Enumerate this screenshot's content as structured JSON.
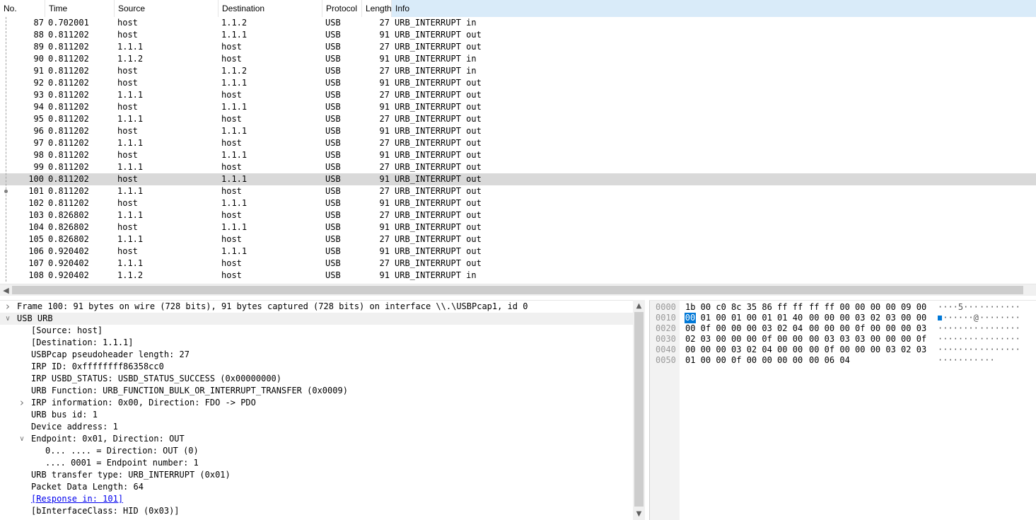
{
  "columns": [
    {
      "key": "no",
      "label": "No."
    },
    {
      "key": "time",
      "label": "Time"
    },
    {
      "key": "source",
      "label": "Source"
    },
    {
      "key": "destination",
      "label": "Destination"
    },
    {
      "key": "protocol",
      "label": "Protocol"
    },
    {
      "key": "length",
      "label": "Length"
    },
    {
      "key": "info",
      "label": "Info"
    }
  ],
  "packets": [
    {
      "no": "87",
      "time": "0.702001",
      "source": "host",
      "destination": "1.1.2",
      "protocol": "USB",
      "length": "27",
      "info": "URB_INTERRUPT in"
    },
    {
      "no": "88",
      "time": "0.811202",
      "source": "host",
      "destination": "1.1.1",
      "protocol": "USB",
      "length": "91",
      "info": "URB_INTERRUPT out"
    },
    {
      "no": "89",
      "time": "0.811202",
      "source": "1.1.1",
      "destination": "host",
      "protocol": "USB",
      "length": "27",
      "info": "URB_INTERRUPT out"
    },
    {
      "no": "90",
      "time": "0.811202",
      "source": "1.1.2",
      "destination": "host",
      "protocol": "USB",
      "length": "91",
      "info": "URB_INTERRUPT in"
    },
    {
      "no": "91",
      "time": "0.811202",
      "source": "host",
      "destination": "1.1.2",
      "protocol": "USB",
      "length": "27",
      "info": "URB_INTERRUPT in"
    },
    {
      "no": "92",
      "time": "0.811202",
      "source": "host",
      "destination": "1.1.1",
      "protocol": "USB",
      "length": "91",
      "info": "URB_INTERRUPT out"
    },
    {
      "no": "93",
      "time": "0.811202",
      "source": "1.1.1",
      "destination": "host",
      "protocol": "USB",
      "length": "27",
      "info": "URB_INTERRUPT out"
    },
    {
      "no": "94",
      "time": "0.811202",
      "source": "host",
      "destination": "1.1.1",
      "protocol": "USB",
      "length": "91",
      "info": "URB_INTERRUPT out"
    },
    {
      "no": "95",
      "time": "0.811202",
      "source": "1.1.1",
      "destination": "host",
      "protocol": "USB",
      "length": "27",
      "info": "URB_INTERRUPT out"
    },
    {
      "no": "96",
      "time": "0.811202",
      "source": "host",
      "destination": "1.1.1",
      "protocol": "USB",
      "length": "91",
      "info": "URB_INTERRUPT out"
    },
    {
      "no": "97",
      "time": "0.811202",
      "source": "1.1.1",
      "destination": "host",
      "protocol": "USB",
      "length": "27",
      "info": "URB_INTERRUPT out"
    },
    {
      "no": "98",
      "time": "0.811202",
      "source": "host",
      "destination": "1.1.1",
      "protocol": "USB",
      "length": "91",
      "info": "URB_INTERRUPT out"
    },
    {
      "no": "99",
      "time": "0.811202",
      "source": "1.1.1",
      "destination": "host",
      "protocol": "USB",
      "length": "27",
      "info": "URB_INTERRUPT out"
    },
    {
      "no": "100",
      "time": "0.811202",
      "source": "host",
      "destination": "1.1.1",
      "protocol": "USB",
      "length": "91",
      "info": "URB_INTERRUPT out",
      "selected": true
    },
    {
      "no": "101",
      "time": "0.811202",
      "source": "1.1.1",
      "destination": "host",
      "protocol": "USB",
      "length": "27",
      "info": "URB_INTERRUPT out"
    },
    {
      "no": "102",
      "time": "0.811202",
      "source": "host",
      "destination": "1.1.1",
      "protocol": "USB",
      "length": "91",
      "info": "URB_INTERRUPT out"
    },
    {
      "no": "103",
      "time": "0.826802",
      "source": "1.1.1",
      "destination": "host",
      "protocol": "USB",
      "length": "27",
      "info": "URB_INTERRUPT out"
    },
    {
      "no": "104",
      "time": "0.826802",
      "source": "host",
      "destination": "1.1.1",
      "protocol": "USB",
      "length": "91",
      "info": "URB_INTERRUPT out"
    },
    {
      "no": "105",
      "time": "0.826802",
      "source": "1.1.1",
      "destination": "host",
      "protocol": "USB",
      "length": "27",
      "info": "URB_INTERRUPT out"
    },
    {
      "no": "106",
      "time": "0.920402",
      "source": "host",
      "destination": "1.1.1",
      "protocol": "USB",
      "length": "91",
      "info": "URB_INTERRUPT out"
    },
    {
      "no": "107",
      "time": "0.920402",
      "source": "1.1.1",
      "destination": "host",
      "protocol": "USB",
      "length": "27",
      "info": "URB_INTERRUPT out"
    },
    {
      "no": "108",
      "time": "0.920402",
      "source": "1.1.2",
      "destination": "host",
      "protocol": "USB",
      "length": "91",
      "info": "URB_INTERRUPT in"
    }
  ],
  "details": [
    {
      "indent": 0,
      "expander": "collapsed",
      "text": "Frame 100: 91 bytes on wire (728 bits), 91 bytes captured (728 bits) on interface \\\\.\\USBPcap1, id 0"
    },
    {
      "indent": 0,
      "expander": "expanded",
      "text": "USB URB",
      "highlight": true
    },
    {
      "indent": 1,
      "text": "[Source: host]"
    },
    {
      "indent": 1,
      "text": "[Destination: 1.1.1]"
    },
    {
      "indent": 1,
      "text": "USBPcap pseudoheader length: 27"
    },
    {
      "indent": 1,
      "text": "IRP ID: 0xffffffff86358cc0"
    },
    {
      "indent": 1,
      "text": "IRP USBD_STATUS: USBD_STATUS_SUCCESS (0x00000000)"
    },
    {
      "indent": 1,
      "text": "URB Function: URB_FUNCTION_BULK_OR_INTERRUPT_TRANSFER (0x0009)"
    },
    {
      "indent": 1,
      "expander": "collapsed",
      "text": "IRP information: 0x00, Direction: FDO -> PDO"
    },
    {
      "indent": 1,
      "text": "URB bus id: 1"
    },
    {
      "indent": 1,
      "text": "Device address: 1"
    },
    {
      "indent": 1,
      "expander": "expanded",
      "text": "Endpoint: 0x01, Direction: OUT"
    },
    {
      "indent": 2,
      "text": "0... .... = Direction: OUT (0)"
    },
    {
      "indent": 2,
      "text": ".... 0001 = Endpoint number: 1"
    },
    {
      "indent": 1,
      "text": "URB transfer type: URB_INTERRUPT (0x01)"
    },
    {
      "indent": 1,
      "text": "Packet Data Length: 64"
    },
    {
      "indent": 1,
      "text": "[Response in: 101]",
      "link": true
    },
    {
      "indent": 1,
      "text": "[bInterfaceClass: HID (0x03)]"
    }
  ],
  "bytes": [
    {
      "offset": "0000",
      "hex1": "1b 00 c0 8c 35 86 ff ff",
      "hex2": "ff ff 00 00 00 00 09 00",
      "ascii1": "····5···",
      "ascii2": "········"
    },
    {
      "offset": "0010",
      "hex1": "00 01 00 01 00 01 01 40",
      "hex2": "00 00 00 03 02 03 00 00",
      "ascii1": "·······@",
      "ascii2": "········",
      "selected_byte": "00"
    },
    {
      "offset": "0020",
      "hex1": "00 0f 00 00 00 03 02 04",
      "hex2": "00 00 00 0f 00 00 00 03",
      "ascii1": "········",
      "ascii2": "········"
    },
    {
      "offset": "0030",
      "hex1": "02 03 00 00 00 0f 00 00",
      "hex2": "00 03 03 03 00 00 00 0f",
      "ascii1": "········",
      "ascii2": "········"
    },
    {
      "offset": "0040",
      "hex1": "00 00 00 03 02 04 00 00",
      "hex2": "00 0f 00 00 00 03 02 03",
      "ascii1": "········",
      "ascii2": "········"
    },
    {
      "offset": "0050",
      "hex1": "01 00 00 0f 00 00 00 00",
      "hex2": "00 06 04",
      "ascii1": "········",
      "ascii2": "···"
    }
  ],
  "colors": {
    "selected_row": "#d9d9d9",
    "header_active": "#d9ebf9",
    "byte_selection": "#0078d7",
    "link": "#0000ee"
  },
  "icons": {
    "collapsed": "chevron-right-icon",
    "expanded": "chevron-down-icon",
    "scroll_left": "arrow-left-icon",
    "scroll_up": "arrow-up-icon",
    "scroll_down": "arrow-down-icon"
  }
}
